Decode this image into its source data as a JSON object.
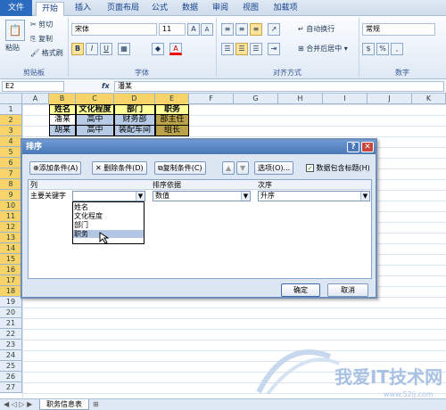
{
  "ribbon_tabs": [
    "文件",
    "开始",
    "插入",
    "页面布局",
    "公式",
    "数据",
    "审阅",
    "视图",
    "加载项"
  ],
  "clipboard": {
    "paste": "粘贴",
    "cut": "剪切",
    "copy": "复制",
    "painter": "格式刷",
    "group": "剪贴板"
  },
  "font": {
    "name": "宋体",
    "size": "11",
    "bold": "B",
    "italic": "I",
    "underline": "U",
    "grow": "A",
    "shrink": "A",
    "fontcolor": "A",
    "group": "字体"
  },
  "align": {
    "wrap": "自动换行",
    "merge": "合并后居中",
    "group": "对齐方式"
  },
  "number": {
    "format": "常规",
    "group": "数字",
    "percent": "%"
  },
  "formula": {
    "cellref": "E2",
    "fx": "fx",
    "value": "潘某"
  },
  "columns": [
    "A",
    "B",
    "C",
    "D",
    "E",
    "F",
    "G",
    "H",
    "I",
    "J",
    "K"
  ],
  "rows": [
    "1",
    "2",
    "3",
    "4",
    "5",
    "6",
    "7",
    "8",
    "9",
    "10",
    "11",
    "12",
    "13",
    "14",
    "15",
    "16",
    "17",
    "18",
    "19",
    "20",
    "21",
    "22",
    "23",
    "24",
    "25",
    "26",
    "27"
  ],
  "cells": {
    "B1": "姓名",
    "C1": "文化程度",
    "D1": "部门",
    "E1": "职务",
    "B2": "潘某",
    "C2": "高中",
    "D2": "财务部",
    "E2": "部主任",
    "B3": "胡某",
    "C3": "高中",
    "D3": "装配车间",
    "E3": "组长"
  },
  "dialog": {
    "title": "排序",
    "help": "?",
    "close": "✕",
    "add": "添加条件(A)",
    "delete": "删除条件(D)",
    "copyc": "复制条件(C)",
    "up": "▲",
    "down": "▼",
    "options": "选项(O)...",
    "header_checkbox": "数据包含标题(H)",
    "col_header": "列",
    "sortby_header": "排序依据",
    "order_header": "次序",
    "row_label": "主要关键字",
    "key_value": "",
    "sortby_value": "数值",
    "order_value": "升序",
    "dropdown": [
      "姓名",
      "文化程度",
      "部门",
      "职务"
    ],
    "ok": "确定",
    "cancel": "取消"
  },
  "sheet_tab": "职务信息表",
  "watermark": {
    "text": "我爱IT技术网",
    "url": "www.52ij.com"
  }
}
